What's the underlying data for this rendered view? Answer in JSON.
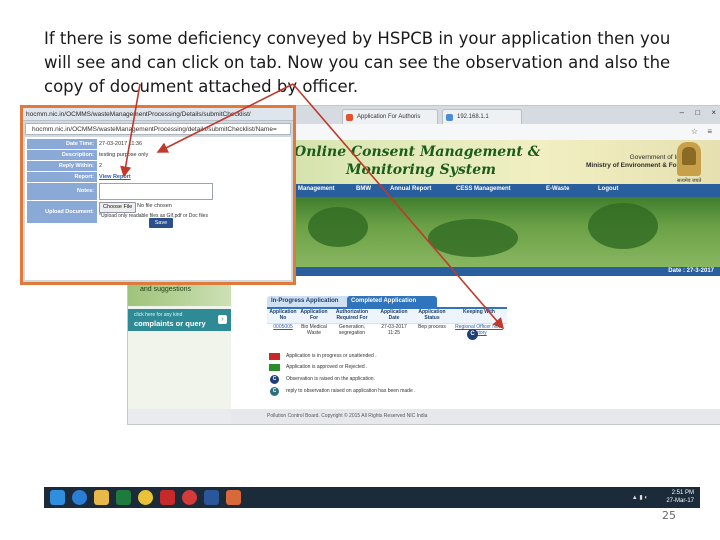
{
  "caption": {
    "line1": "If there is some deficiency conveyed by HSPCB in your application then you",
    "line2": "will see and can click on tab. Now you can see the observation and also the",
    "line3": "copy of document attached by officer."
  },
  "browser": {
    "tabs": [
      {
        "label": "Application For Authoris",
        "color": "#e2532f"
      },
      {
        "label": "192.168.1.1",
        "color": "#4c8bd6"
      }
    ],
    "window_controls": {
      "minimize": "–",
      "maximize": "□",
      "close": "×"
    }
  },
  "site": {
    "title_line1": "Online Consent Management &",
    "title_line2": "Monitoring System",
    "gov_line1": "Government of India",
    "gov_line2": "Ministry of Environment & Forest",
    "emblem_text": "सत्यमेव जयते",
    "nav_items": [
      "Management",
      "BMW",
      "Annual Report",
      "CESS Management",
      "E-Waste",
      "Logout"
    ],
    "date_text": "Date : 27-3-2017",
    "suggestions": "and suggestions",
    "complaints_line1": "click here for any kind",
    "complaints_line2": "complaints or query",
    "tabs": {
      "inprogress": "In-Progress Application",
      "completed": "Completed Application"
    },
    "table": {
      "headers": [
        "Application No",
        "Application For",
        "Authorization Required For",
        "Application Date",
        "Application Status",
        "Keeping With"
      ],
      "rows": [
        [
          "0005005",
          "Bio Medical Waste",
          "Generation, segregation",
          "27-03-2017 11:25",
          "Bep process",
          "Regional Officer Note History"
        ]
      ]
    },
    "legend": [
      {
        "color": "#c8282a",
        "text": "Application is in progress or unattended ."
      },
      {
        "color": "#2a8c2a",
        "text": "Application is approved or Rejected ."
      },
      {
        "icon": "C",
        "text": "Observation is raised on the application."
      },
      {
        "icon": "C",
        "text": "reply to observation raised on application has been made ."
      }
    ],
    "footer": "Pollution Control Board. Copyright © 2015 All Rights Reserved NIC India"
  },
  "popup": {
    "title": "hocmm.nic.in/OCMMS/wasteManagementProcessing/Details/submitChecklist/",
    "url": "hocmm.nic.in/OCMMS/wasteManagementProcessing/details/submitChecklist/Name=",
    "fields": [
      {
        "label": "Date Time:",
        "value": "27-03-2017 11:36"
      },
      {
        "label": "Description:",
        "value": "testing purpose only"
      },
      {
        "label": "Reply Within:",
        "value": "2"
      },
      {
        "label": "Report:",
        "value": "View Report"
      }
    ],
    "notes_label": "Notes:",
    "upload_label": "Upload Document:",
    "choose_file": "Choose File",
    "no_file": "No file chosen",
    "upload_hint": "*Upload only readable files as GIf,pdf or Doc files",
    "save": "Save"
  },
  "taskbar": {
    "time": "2:51 PM",
    "date": "27-Mar-17",
    "icons": [
      {
        "name": "windows-start-icon",
        "color": "#2f8fde"
      },
      {
        "name": "internet-explorer-icon",
        "color": "#2a7fd4"
      },
      {
        "name": "file-explorer-icon",
        "color": "#e7b84a"
      },
      {
        "name": "excel-icon",
        "color": "#1f7a3d"
      },
      {
        "name": "chrome-icon",
        "color": "#e8c33a"
      },
      {
        "name": "adobe-icon",
        "color": "#c62a2a"
      },
      {
        "name": "opera-icon",
        "color": "#d33a3a"
      },
      {
        "name": "word-icon",
        "color": "#2b579a"
      },
      {
        "name": "paint-icon",
        "color": "#d9683a"
      }
    ]
  },
  "slide": {
    "page_number": "25"
  },
  "colors": {
    "arrow": "#c0392b",
    "popup_border": "#e07a3a",
    "nav": "#2a5f9e"
  }
}
